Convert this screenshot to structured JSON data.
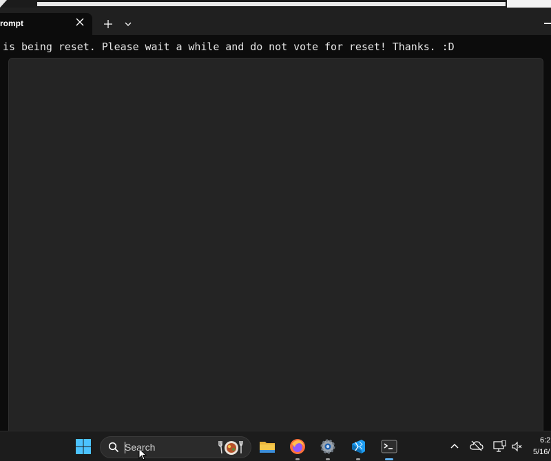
{
  "window": {
    "tab_title": "rompt"
  },
  "terminal": {
    "line": "is being reset. Please wait a while and do not vote for reset! Thanks. :D"
  },
  "taskbar": {
    "search_placeholder": "Search",
    "apps": [
      "start-icon",
      "file-explorer-icon",
      "firefox-icon",
      "settings-icon",
      "vscode-icon",
      "terminal-icon"
    ],
    "time": "6:2",
    "date": "5/16/"
  },
  "colors": {
    "background": "#0c0c0c",
    "titlebar": "#202020",
    "panel": "#242424",
    "taskbar": "#1c1c1c",
    "accent_blue": "#0078d4"
  }
}
